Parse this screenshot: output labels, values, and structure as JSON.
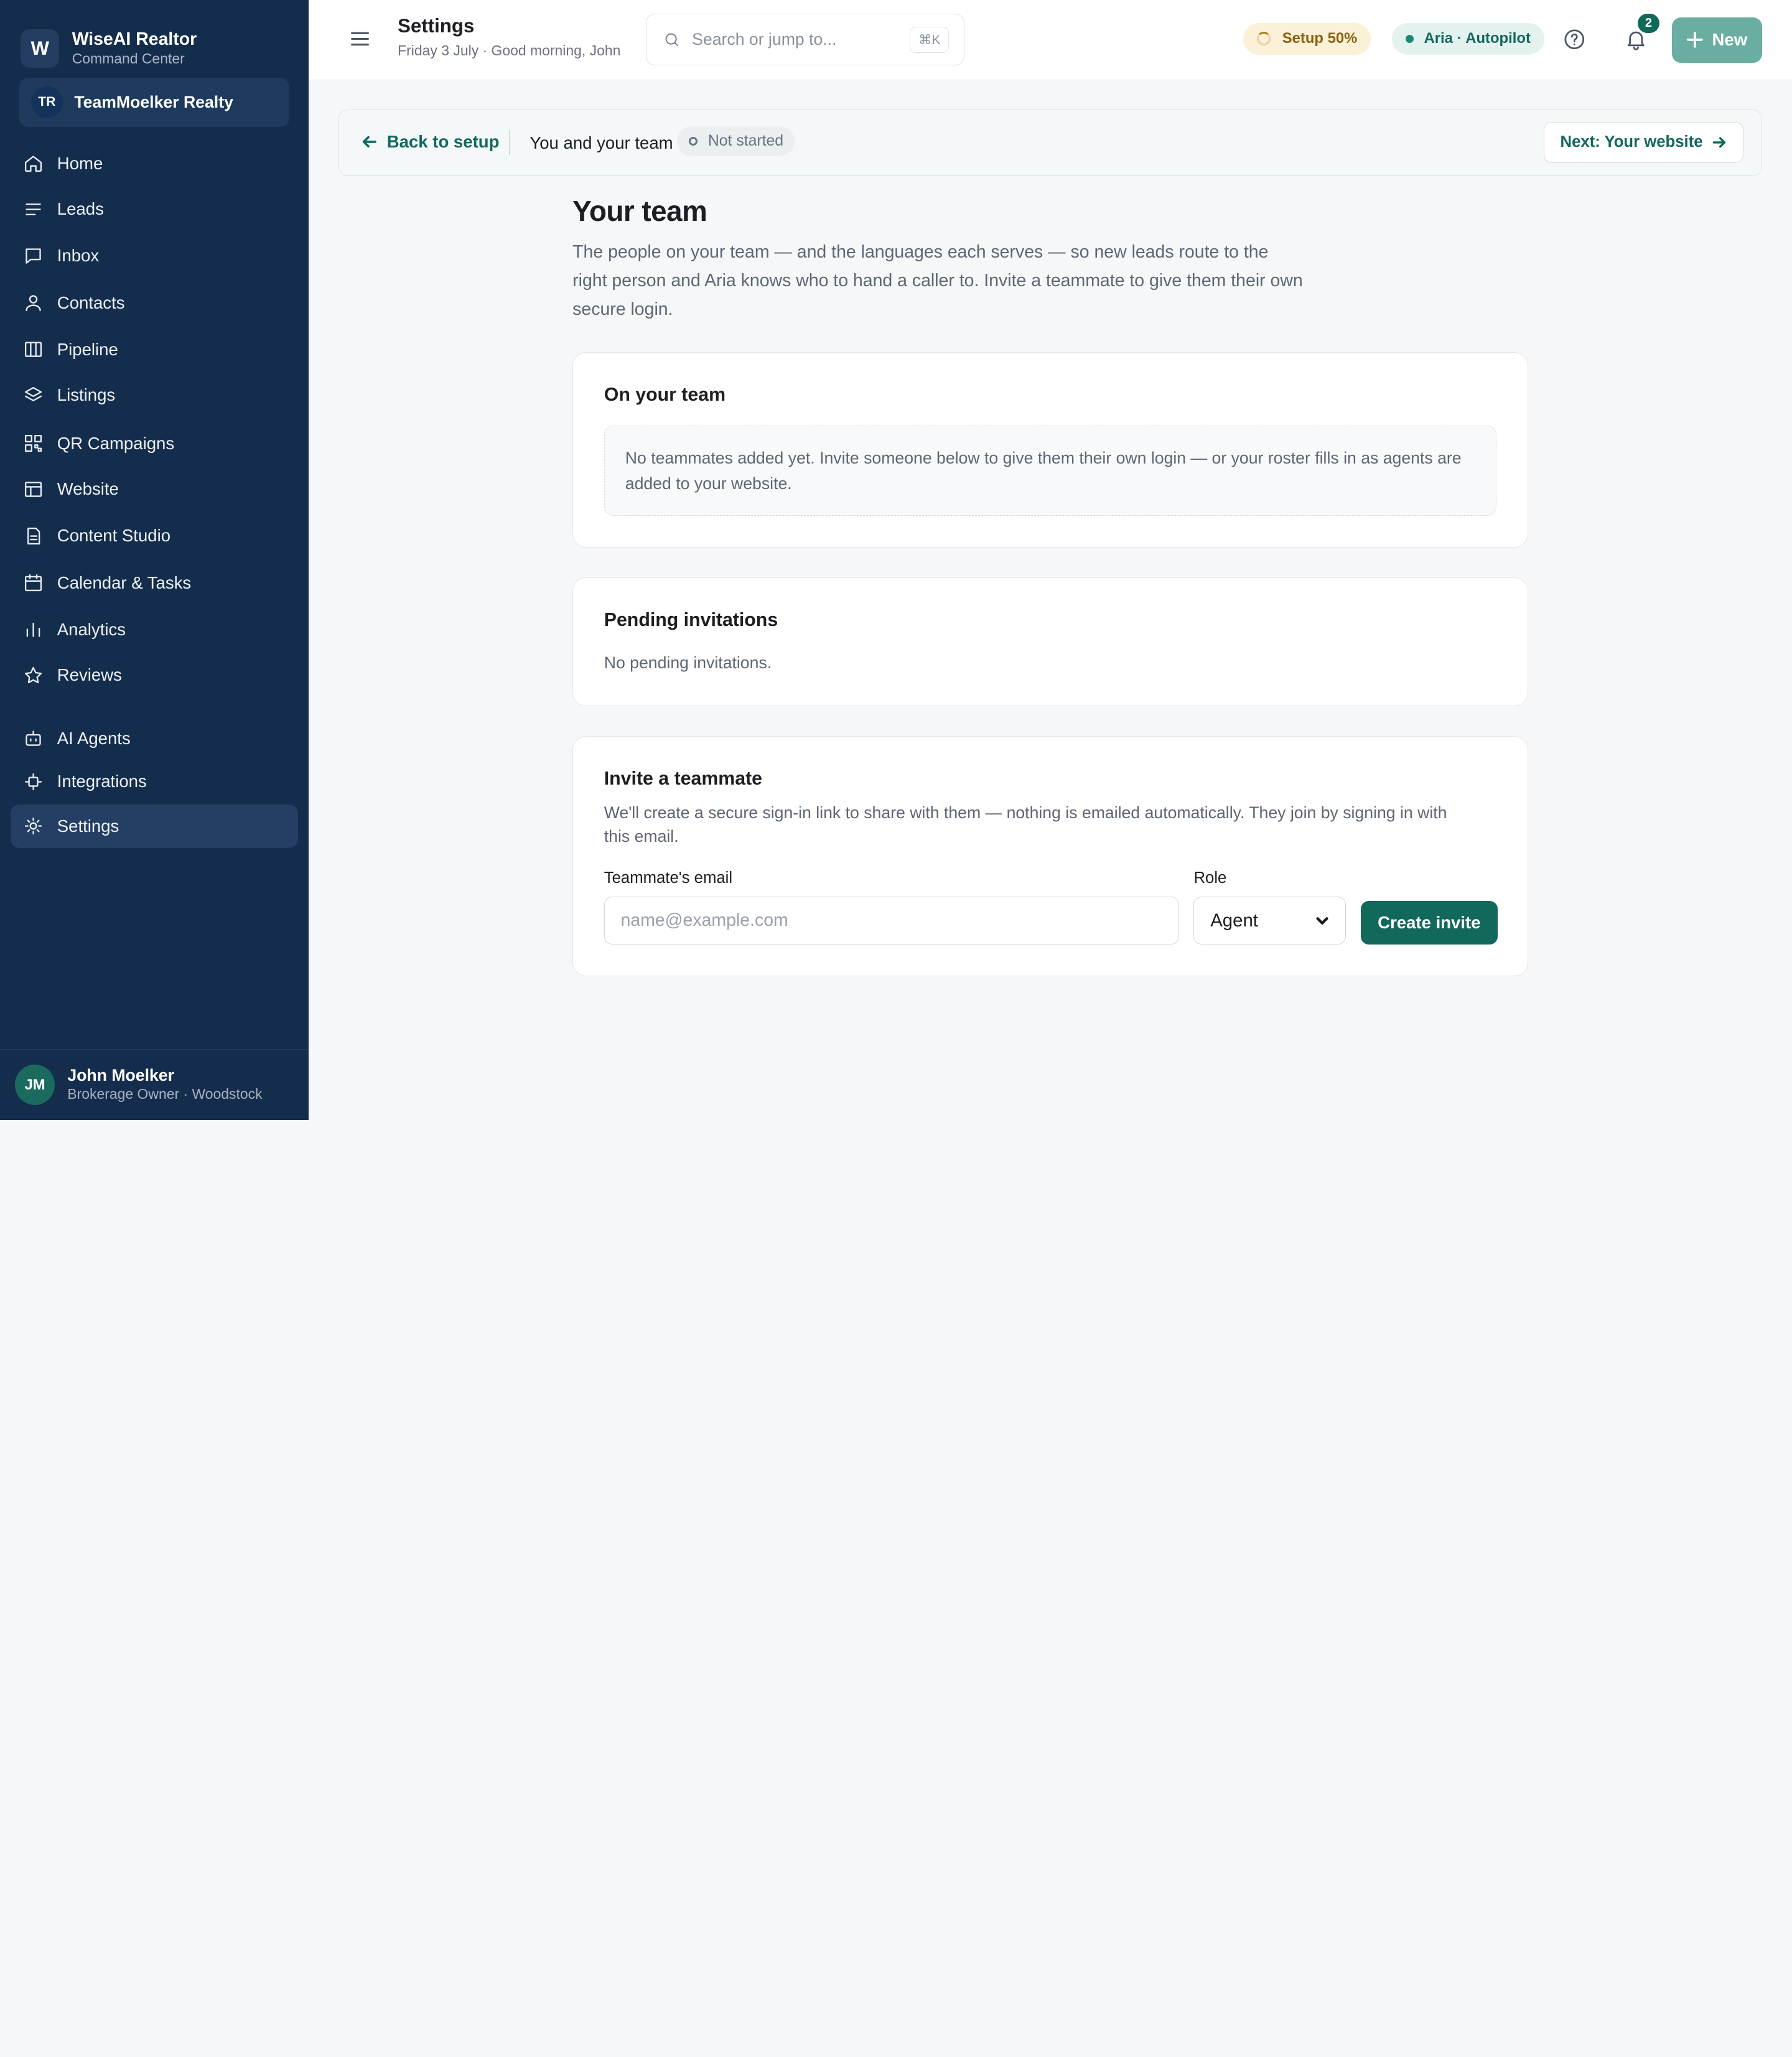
{
  "brand": {
    "logo_letter": "W",
    "name": "WiseAI Realtor",
    "subtitle": "Command Center"
  },
  "org": {
    "initials": "TR",
    "name": "TeamMoelker Realty"
  },
  "sidebar": {
    "items": [
      {
        "label": "Home",
        "icon": "home-icon"
      },
      {
        "label": "Leads",
        "icon": "list-icon"
      },
      {
        "label": "Inbox",
        "icon": "message-icon"
      },
      {
        "label": "Contacts",
        "icon": "user-icon"
      },
      {
        "label": "Pipeline",
        "icon": "columns-icon"
      },
      {
        "label": "Listings",
        "icon": "layers-icon"
      },
      {
        "label": "QR Campaigns",
        "icon": "qr-icon"
      },
      {
        "label": "Website",
        "icon": "layout-icon"
      },
      {
        "label": "Content Studio",
        "icon": "file-icon"
      },
      {
        "label": "Calendar & Tasks",
        "icon": "calendar-icon"
      },
      {
        "label": "Analytics",
        "icon": "bar-chart-icon"
      },
      {
        "label": "Reviews",
        "icon": "star-icon"
      },
      {
        "label": "AI Agents",
        "icon": "robot-icon"
      },
      {
        "label": "Integrations",
        "icon": "plug-icon"
      },
      {
        "label": "Settings",
        "icon": "sun-icon",
        "active": true
      }
    ]
  },
  "user": {
    "initials": "JM",
    "name": "John Moelker",
    "role": "Brokerage Owner · Woodstock"
  },
  "header": {
    "title": "Settings",
    "subtitle": "Friday 3 July · Good morning, John",
    "search_placeholder": "Search or jump to...",
    "search_shortcut": "⌘K",
    "setup_pill": "Setup 50%",
    "aria_pill": "Aria · Autopilot",
    "notification_count": "2",
    "new_label": "New"
  },
  "setupbar": {
    "back_label": "Back to setup",
    "step_name": "You and your team",
    "status": "Not started",
    "next_label": "Next: Your website"
  },
  "page": {
    "title": "Your team",
    "intro": "The people on your team — and the languages each serves — so new leads route to the right person and Aria knows who to hand a caller to. Invite a teammate to give them their own secure login."
  },
  "team_card": {
    "title": "On your team",
    "empty": "No teammates added yet. Invite someone below to give them their own login — or your roster fills in as agents are added to your website."
  },
  "pending_card": {
    "title": "Pending invitations",
    "empty": "No pending invitations."
  },
  "invite_card": {
    "title": "Invite a teammate",
    "description": "We'll create a secure sign-in link to share with them — nothing is emailed automatically. They join by signing in with this email.",
    "email_label": "Teammate's email",
    "email_placeholder": "name@example.com",
    "role_label": "Role",
    "role_value": "Agent",
    "submit_label": "Create invite"
  },
  "colors": {
    "sidebar": "#142d4c",
    "accent": "#13685c",
    "setup_pill_bg": "#fbf0d8",
    "aria_pill_bg": "#e4f2ef"
  }
}
